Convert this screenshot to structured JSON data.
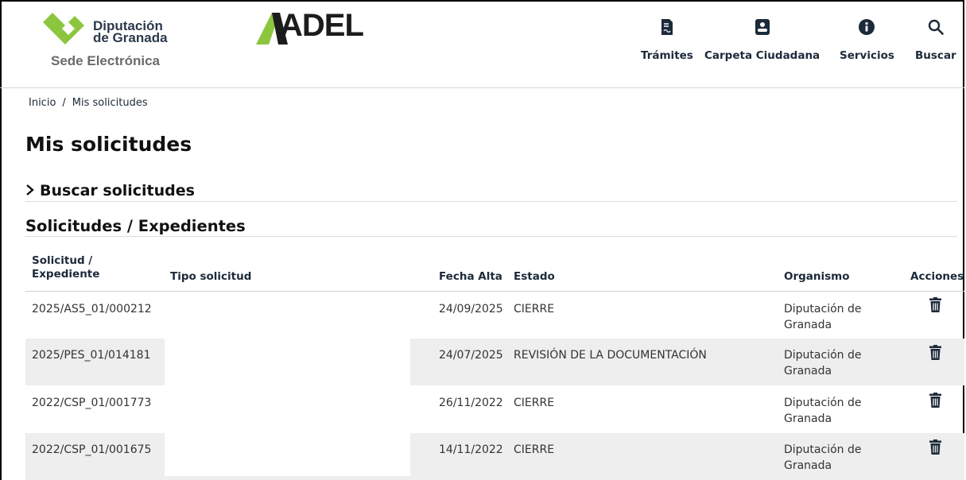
{
  "header": {
    "logo_line1": "Diputación",
    "logo_line2": "de Granada",
    "logo_subtitle": "Sede Electrónica",
    "brand": "ADEL",
    "nav": [
      {
        "label": "Trámites",
        "icon": "document-sign-icon"
      },
      {
        "label": "Carpeta Ciudadana",
        "icon": "user-badge-icon"
      },
      {
        "label": "Servicios",
        "icon": "info-circle-icon"
      },
      {
        "label": "Buscar",
        "icon": "search-icon"
      }
    ]
  },
  "breadcrumb": {
    "home": "Inicio",
    "separator": "/",
    "current": "Mis solicitudes"
  },
  "page_title": "Mis solicitudes",
  "search_section": "Buscar solicitudes",
  "list_section": "Solicitudes / Expedientes",
  "table": {
    "headers": {
      "solicitud_line1": "Solicitud /",
      "solicitud_line2": "Expediente",
      "tipo": "Tipo solicitud",
      "fecha": "Fecha Alta",
      "estado": "Estado",
      "organismo": "Organismo",
      "acciones": "Acciones"
    },
    "rows": [
      {
        "id": "2025/AS5_01/000212",
        "fecha": "24/09/2025",
        "estado": "CIERRE",
        "org1": "Diputación de",
        "org2": "Granada"
      },
      {
        "id": "2025/PES_01/014181",
        "fecha": "24/07/2025",
        "estado": "REVISIÓN DE LA DOCUMENTACIÓN",
        "org1": "Diputación de",
        "org2": "Granada"
      },
      {
        "id": "2022/CSP_01/001773",
        "fecha": "26/11/2022",
        "estado": "CIERRE",
        "org1": "Diputación de",
        "org2": "Granada"
      },
      {
        "id": "2022/CSP_01/001675",
        "fecha": "14/11/2022",
        "estado": "CIERRE",
        "org1": "Diputación de",
        "org2": "Granada"
      }
    ]
  },
  "colors": {
    "brand_green": "#8cc63f",
    "nav_text": "#1c2a3a",
    "row_alt": "#eeeeee"
  }
}
